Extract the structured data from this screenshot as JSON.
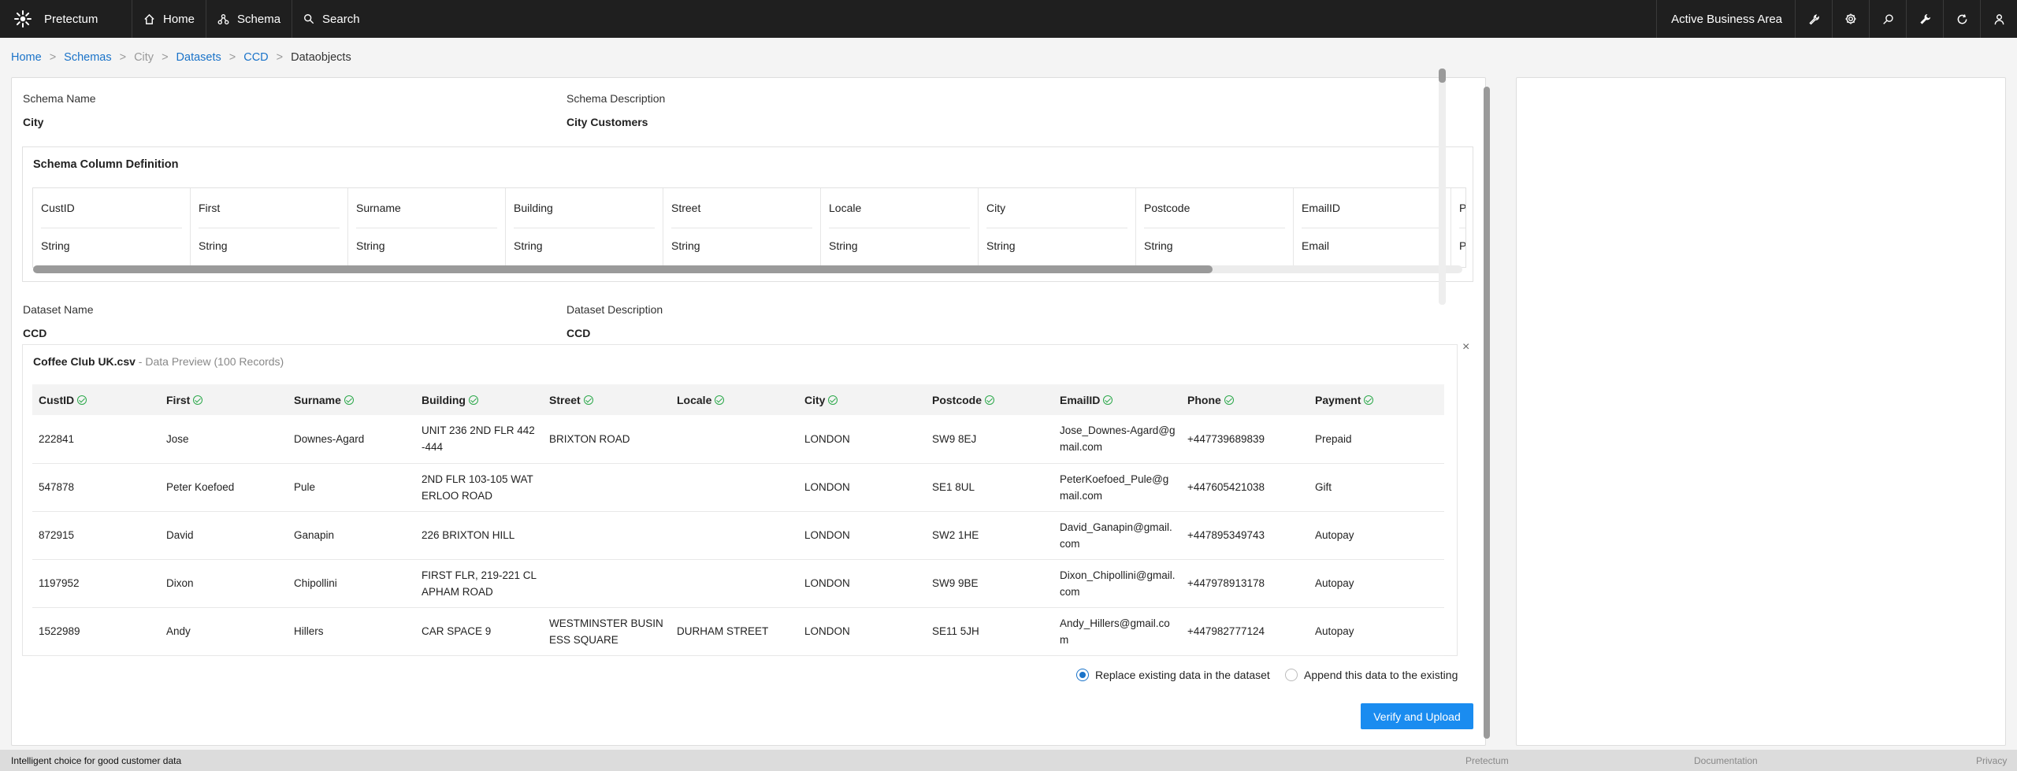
{
  "app": {
    "name": "Pretectum"
  },
  "nav": {
    "home": "Home",
    "schema": "Schema",
    "search": "Search"
  },
  "topbar": {
    "area": "Active Business Area"
  },
  "breadcrumb": [
    "Home",
    "Schemas",
    "City",
    "Datasets",
    "CCD",
    "Dataobjects"
  ],
  "schema": {
    "name_label": "Schema Name",
    "name": "City",
    "description_label": "Schema Description",
    "description": "City Customers",
    "definition_title": "Schema Column Definition",
    "columns": [
      {
        "name": "CustID",
        "type": "String"
      },
      {
        "name": "First",
        "type": "String"
      },
      {
        "name": "Surname",
        "type": "String"
      },
      {
        "name": "Building",
        "type": "String"
      },
      {
        "name": "Street",
        "type": "String"
      },
      {
        "name": "Locale",
        "type": "String"
      },
      {
        "name": "City",
        "type": "String"
      },
      {
        "name": "Postcode",
        "type": "String"
      },
      {
        "name": "EmailID",
        "type": "Email"
      },
      {
        "name": "P",
        "type": "P"
      }
    ]
  },
  "dataset": {
    "name_label": "Dataset Name",
    "name": "CCD",
    "description_label": "Dataset Description",
    "description": "CCD"
  },
  "preview": {
    "file": "Coffee Club UK.csv",
    "subtitle": " - Data Preview (100 Records)",
    "headers": [
      "CustID",
      "First",
      "Surname",
      "Building",
      "Street",
      "Locale",
      "City",
      "Postcode",
      "EmailID",
      "Phone",
      "Payment"
    ],
    "rows": [
      [
        "222841",
        "Jose",
        "Downes-Agard",
        "UNIT 236 2ND FLR 442-444",
        "BRIXTON ROAD",
        "",
        "LONDON",
        "SW9 8EJ",
        "Jose_Downes-Agard@gmail.com",
        "+447739689839",
        "Prepaid"
      ],
      [
        "547878",
        "Peter Koefoed",
        "Pule",
        "2ND FLR 103-105 WATERLOO ROAD",
        "",
        "",
        "LONDON",
        "SE1 8UL",
        "PeterKoefoed_Pule@gmail.com",
        "+447605421038",
        "Gift"
      ],
      [
        "872915",
        "David",
        "Ganapin",
        "226 BRIXTON HILL",
        "",
        "",
        "LONDON",
        "SW2 1HE",
        "David_Ganapin@gmail.com",
        "+447895349743",
        "Autopay"
      ],
      [
        "1197952",
        "Dixon",
        "Chipollini",
        "FIRST FLR, 219-221 CLAPHAM ROAD",
        "",
        "",
        "LONDON",
        "SW9 9BE",
        "Dixon_Chipollini@gmail.com",
        "+447978913178",
        "Autopay"
      ],
      [
        "1522989",
        "Andy",
        "Hillers",
        "CAR SPACE 9",
        "WESTMINSTER BUSINESS SQUARE",
        "DURHAM STREET",
        "LONDON",
        "SE11 5JH",
        "Andy_Hillers@gmail.com",
        "+447982777124",
        "Autopay"
      ]
    ]
  },
  "options": {
    "replace": "Replace existing data in the dataset",
    "append": "Append this data to the existing",
    "selected": "replace"
  },
  "actions": {
    "verify_upload": "Verify and Upload"
  },
  "footer": {
    "tagline": "Intelligent choice for good customer data",
    "links": [
      "Pretectum",
      "Documentation",
      "Privacy"
    ]
  },
  "colors": {
    "accent": "#1a8cf0",
    "link": "#1a73c9",
    "topbar": "#1f1f1f",
    "valid": "#2ba84a"
  }
}
